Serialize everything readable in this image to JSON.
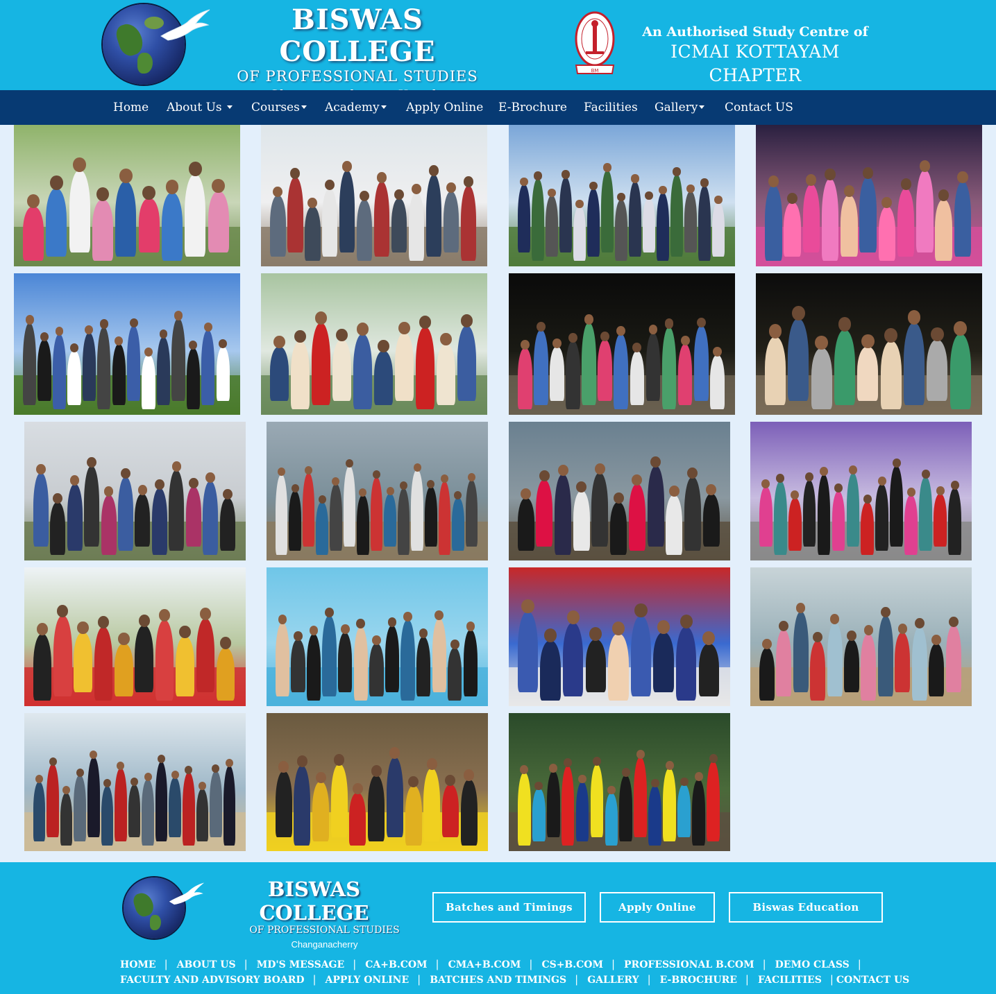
{
  "header": {
    "college_name": "BISWAS COLLEGE",
    "college_sub": "OF PROFESSIONAL STUDIES",
    "college_location": "Changanacherry, Kerala",
    "study_centre_line1": "An Authorised Study Centre of",
    "study_centre_line2": "ICMAI KOTTAYAM CHAPTER",
    "icmai_ring_text": "THE INSTITUTE OF COST ACCOUNTANTS OF INDIA"
  },
  "nav": {
    "items": [
      {
        "label": "Home",
        "dropdown": false
      },
      {
        "label": "About Us",
        "dropdown": true
      },
      {
        "label": "Courses",
        "dropdown": true
      },
      {
        "label": "Academy",
        "dropdown": true
      },
      {
        "label": "Apply Online",
        "dropdown": false
      },
      {
        "label": "E-Brochure",
        "dropdown": false
      },
      {
        "label": "Facilities",
        "dropdown": false
      },
      {
        "label": "Gallery",
        "dropdown": true
      },
      {
        "label": "Contact US",
        "dropdown": false
      }
    ]
  },
  "gallery": {
    "photos": [
      {
        "scene": "group-under-tree"
      },
      {
        "scene": "group-on-beach-overcast"
      },
      {
        "scene": "boys-on-hill-tea-garden"
      },
      {
        "scene": "girls-in-party-bus"
      },
      {
        "scene": "group-at-church-steps"
      },
      {
        "scene": "group-selfie-under-tree"
      },
      {
        "scene": "group-at-night-campfire"
      },
      {
        "scene": "girls-at-night-campfire"
      },
      {
        "scene": "group-at-hill-station-building"
      },
      {
        "scene": "boys-in-sea-waves"
      },
      {
        "scene": "boys-at-beach-evening"
      },
      {
        "scene": "girls-at-amusement-park"
      },
      {
        "scene": "group-on-roller-coaster"
      },
      {
        "scene": "crowd-in-wave-pool"
      },
      {
        "scene": "girls-on-thrill-ride"
      },
      {
        "scene": "girls-on-beach-sand"
      },
      {
        "scene": "group-on-beach-morning"
      },
      {
        "scene": "kids-on-caterpillar-ride"
      },
      {
        "scene": "boys-in-forest"
      }
    ]
  },
  "footer": {
    "college_name": "BISWAS COLLEGE",
    "college_sub": "OF PROFESSIONAL STUDIES",
    "college_location": "Changanacherry",
    "buttons": [
      "Batches and Timings",
      "Apply Online",
      "Biswas Education"
    ],
    "links_row1": [
      "HOME",
      "ABOUT US",
      "MD'S MESSAGE",
      "CA+B.COM",
      "CMA+B.COM",
      "CS+B.COM",
      "PROFESSIONAL B.COM",
      "DEMO CLASS"
    ],
    "links_row2": [
      "FACULTY AND ADVISORY BOARD",
      "APPLY ONLINE",
      "BATCHES AND TIMINGS",
      "GALLERY",
      "E-BROCHURE",
      "FACILITIES",
      "CONTACT US"
    ]
  },
  "colors": {
    "header_bg": "#16b5e3",
    "nav_bg": "#073a73",
    "page_bg": "#e3effb"
  }
}
